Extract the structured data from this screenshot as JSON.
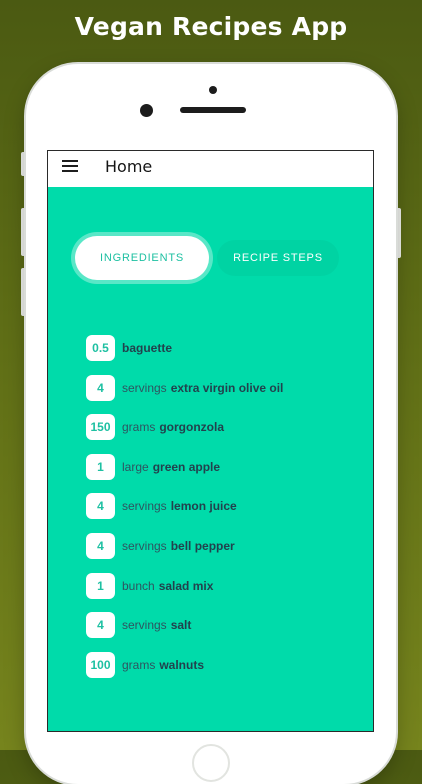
{
  "promo": {
    "title": "Vegan Recipes App"
  },
  "appbar": {
    "title": "Home",
    "menu_icon": "hamburger-menu-icon"
  },
  "tabs": [
    {
      "label": "INGREDIENTS",
      "active": true
    },
    {
      "label": "RECIPE STEPS",
      "active": false
    }
  ],
  "ingredients": [
    {
      "qty": "0.5",
      "unit": "",
      "name": "baguette"
    },
    {
      "qty": "4",
      "unit": "servings",
      "name": "extra virgin olive oil"
    },
    {
      "qty": "150",
      "unit": "grams",
      "name": "gorgonzola"
    },
    {
      "qty": "1",
      "unit": "large",
      "name": "green apple"
    },
    {
      "qty": "4",
      "unit": "servings",
      "name": "lemon juice"
    },
    {
      "qty": "4",
      "unit": "servings",
      "name": "bell pepper"
    },
    {
      "qty": "1",
      "unit": "bunch",
      "name": "salad mix"
    },
    {
      "qty": "4",
      "unit": "servings",
      "name": "salt"
    },
    {
      "qty": "100",
      "unit": "grams",
      "name": "walnuts"
    }
  ],
  "colors": {
    "background_dark": "#4b5a12",
    "background_light": "#76841d",
    "screen_accent": "#00dbaa",
    "quantity_text": "#1ec0a2",
    "ingredient_text": "#22424d"
  }
}
